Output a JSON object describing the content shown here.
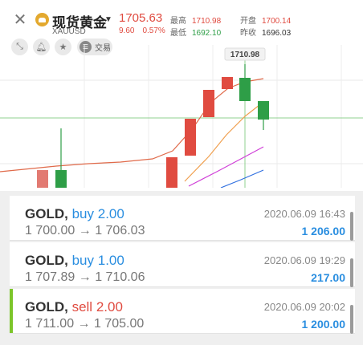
{
  "header": {
    "title": "现货黄金",
    "symbol": "XAUUSD",
    "price": "1705.63",
    "change": "9.60",
    "change_pct": "0.57%",
    "stats": {
      "high_label": "最高",
      "high_value": "1710.98",
      "open_label": "开盘",
      "open_value": "1700.14",
      "low_label": "最低",
      "low_value": "1692.10",
      "prev_label": "昨收",
      "prev_value": "1696.03"
    },
    "trade_label": "交易"
  },
  "chart": {
    "peak_label": "1710.98",
    "colors": {
      "up": "#e04b40",
      "down": "#2e9e47",
      "ma1": "#e06a4a",
      "ma2": "#f0a050",
      "ma3": "#d040d8",
      "ma4": "#3070e0",
      "crosshair": "#8fd08f"
    }
  },
  "orders": [
    {
      "symbol": "GOLD,",
      "side": "buy",
      "lots": "2.00",
      "open_price": "1 700.00",
      "arrow": "→",
      "current_price": "1 706.03",
      "time": "2020.06.09 16:43",
      "amount": "1 206.00"
    },
    {
      "symbol": "GOLD,",
      "side": "buy",
      "lots": "1.00",
      "open_price": "1 707.89",
      "arrow": "→",
      "current_price": "1 710.06",
      "time": "2020.06.09 19:29",
      "amount": "217.00"
    },
    {
      "symbol": "GOLD,",
      "side": "sell",
      "lots": "2.00",
      "open_price": "1 711.00",
      "arrow": "→",
      "current_price": "1 705.00",
      "time": "2020.06.09 20:02",
      "amount": "1 200.00"
    }
  ]
}
